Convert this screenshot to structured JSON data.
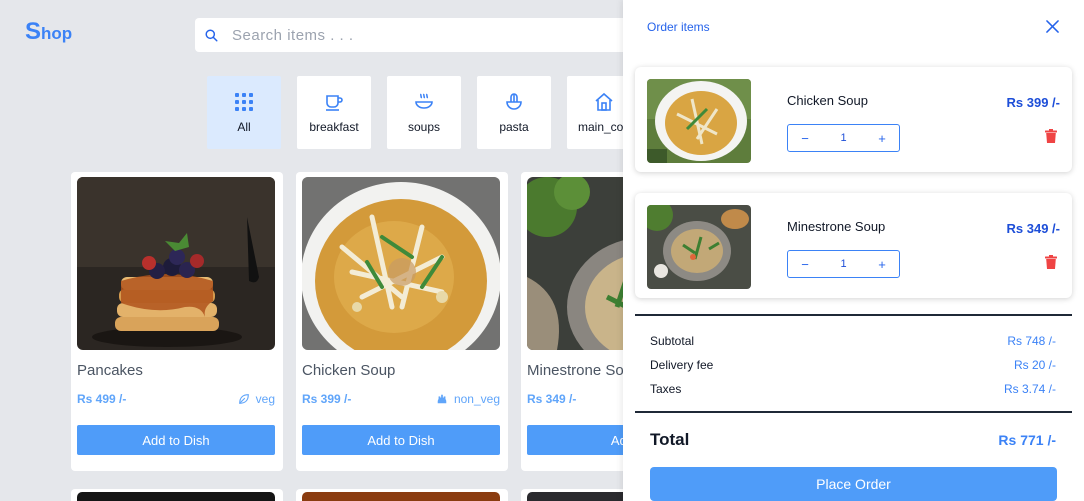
{
  "app": {
    "logo_initial": "S",
    "logo_rest": "hop"
  },
  "search": {
    "placeholder": "Search items . . ."
  },
  "categories": [
    {
      "label": "All",
      "icon": "grid-icon",
      "active": true
    },
    {
      "label": "breakfast",
      "icon": "coffee-cup-icon"
    },
    {
      "label": "soups",
      "icon": "soup-bowl-icon"
    },
    {
      "label": "pasta",
      "icon": "pasta-bowl-icon"
    },
    {
      "label": "main_cou",
      "icon": "home-icon"
    }
  ],
  "products": [
    {
      "name": "Pancakes",
      "price": "Rs 499 /-",
      "tag": "veg",
      "tag_icon": "leaf-icon",
      "button": "Add to Dish"
    },
    {
      "name": "Chicken Soup",
      "price": "Rs 399 /-",
      "tag": "non_veg",
      "tag_icon": "meat-icon",
      "button": "Add to Dish"
    },
    {
      "name": "Minestrone So",
      "price": "Rs 349 /-",
      "button": "Add t"
    }
  ],
  "drawer": {
    "title": "Order items",
    "items": [
      {
        "name": "Chicken Soup",
        "price": "Rs 399 /-",
        "qty": "1",
        "minus": "−",
        "plus": "+"
      },
      {
        "name": "Minestrone Soup",
        "price": "Rs 349 /-",
        "qty": "1",
        "minus": "−",
        "plus": "+"
      }
    ],
    "summary": {
      "subtotal_label": "Subtotal",
      "subtotal": "Rs 748 /-",
      "delivery_label": "Delivery fee",
      "delivery": "Rs 20 /-",
      "taxes_label": "Taxes",
      "taxes": "Rs 3.74 /-",
      "total_label": "Total",
      "total": "Rs 771 /-"
    },
    "place_order": "Place Order"
  },
  "colors": {
    "accent": "#4f9cf9",
    "price_dark": "#1d4ed8",
    "delete": "#ef4444",
    "active_category": "#dbeafe"
  }
}
